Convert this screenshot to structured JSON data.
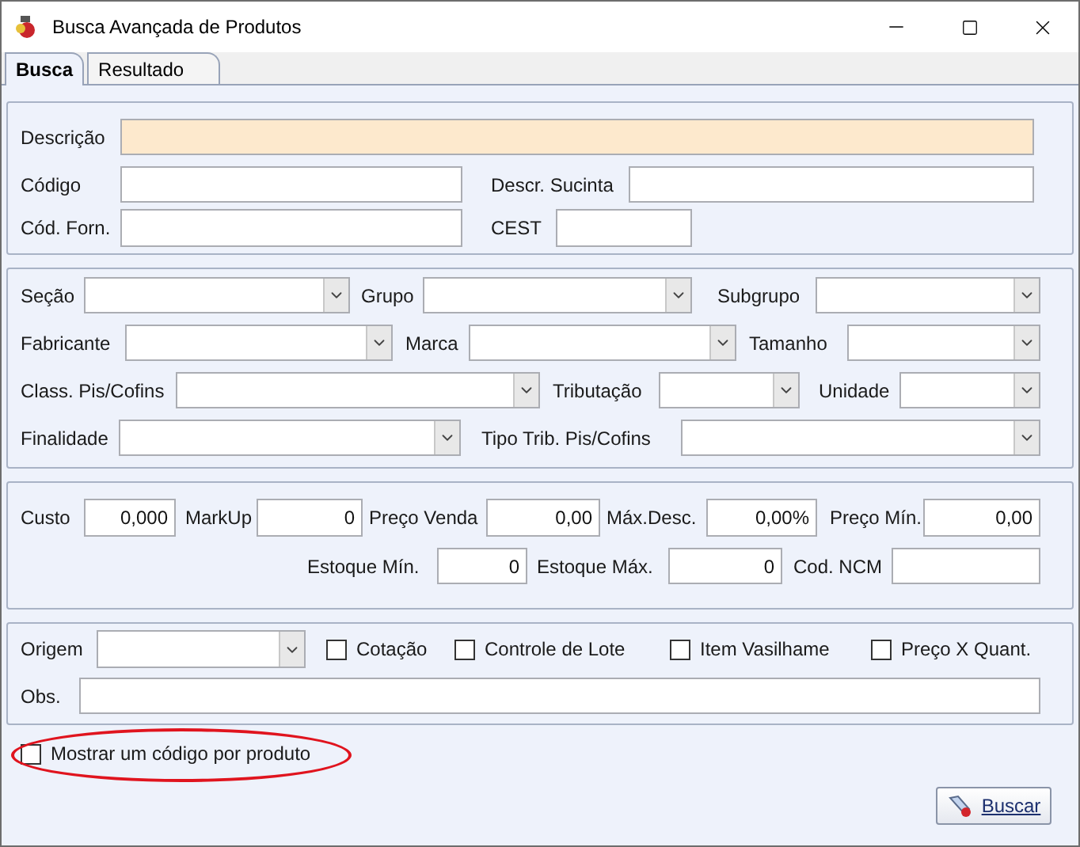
{
  "window": {
    "title": "Busca Avançada de Produtos"
  },
  "tabs": [
    {
      "label": "Busca",
      "selected": true
    },
    {
      "label": "Resultado",
      "selected": false
    }
  ],
  "identification": [
    {
      "label": "Descrição",
      "focused": true
    },
    {
      "label": "Código",
      "focused": false
    },
    {
      "label": "Descr. Sucinta",
      "focused": false
    },
    {
      "label": "Cód. Forn.",
      "focused": false
    },
    {
      "label": "CEST",
      "focused": false
    }
  ],
  "classification": [
    {
      "label": "Seção"
    },
    {
      "label": "Grupo"
    },
    {
      "label": "Subgrupo"
    },
    {
      "label": "Fabricante"
    },
    {
      "label": "Marca"
    },
    {
      "label": "Tamanho"
    },
    {
      "label": "Class. Pis/Cofins"
    },
    {
      "label": "Tributação"
    },
    {
      "label": "Unidade"
    },
    {
      "label": "Finalidade"
    },
    {
      "label": "Tipo Trib. Pis/Cofins"
    }
  ],
  "prices": [
    {
      "label": "Custo",
      "value": "0,000"
    },
    {
      "label": "MarkUp",
      "value": "0"
    },
    {
      "label": "Preço Venda",
      "value": "0,00"
    },
    {
      "label": "Máx.Desc.",
      "value": "0,00%"
    },
    {
      "label": "Preço Mín.",
      "value": "0,00"
    },
    {
      "label": "Estoque Mín.",
      "value": "0"
    },
    {
      "label": "Estoque Máx.",
      "value": "0"
    },
    {
      "label": "Cod. NCM"
    }
  ],
  "other": {
    "origin_label": "Origem",
    "checkboxes": [
      {
        "label": "Cotação",
        "checked": false
      },
      {
        "label": "Controle de Lote",
        "checked": false
      },
      {
        "label": "Item Vasilhame",
        "checked": false
      },
      {
        "label": "Preço X Quant.",
        "checked": false
      }
    ],
    "notes_label": "Obs."
  },
  "one_code_option": {
    "label": "Mostrar um código por produto",
    "checked": false,
    "highlighted": true
  },
  "search_button": {
    "label": "Buscar"
  }
}
